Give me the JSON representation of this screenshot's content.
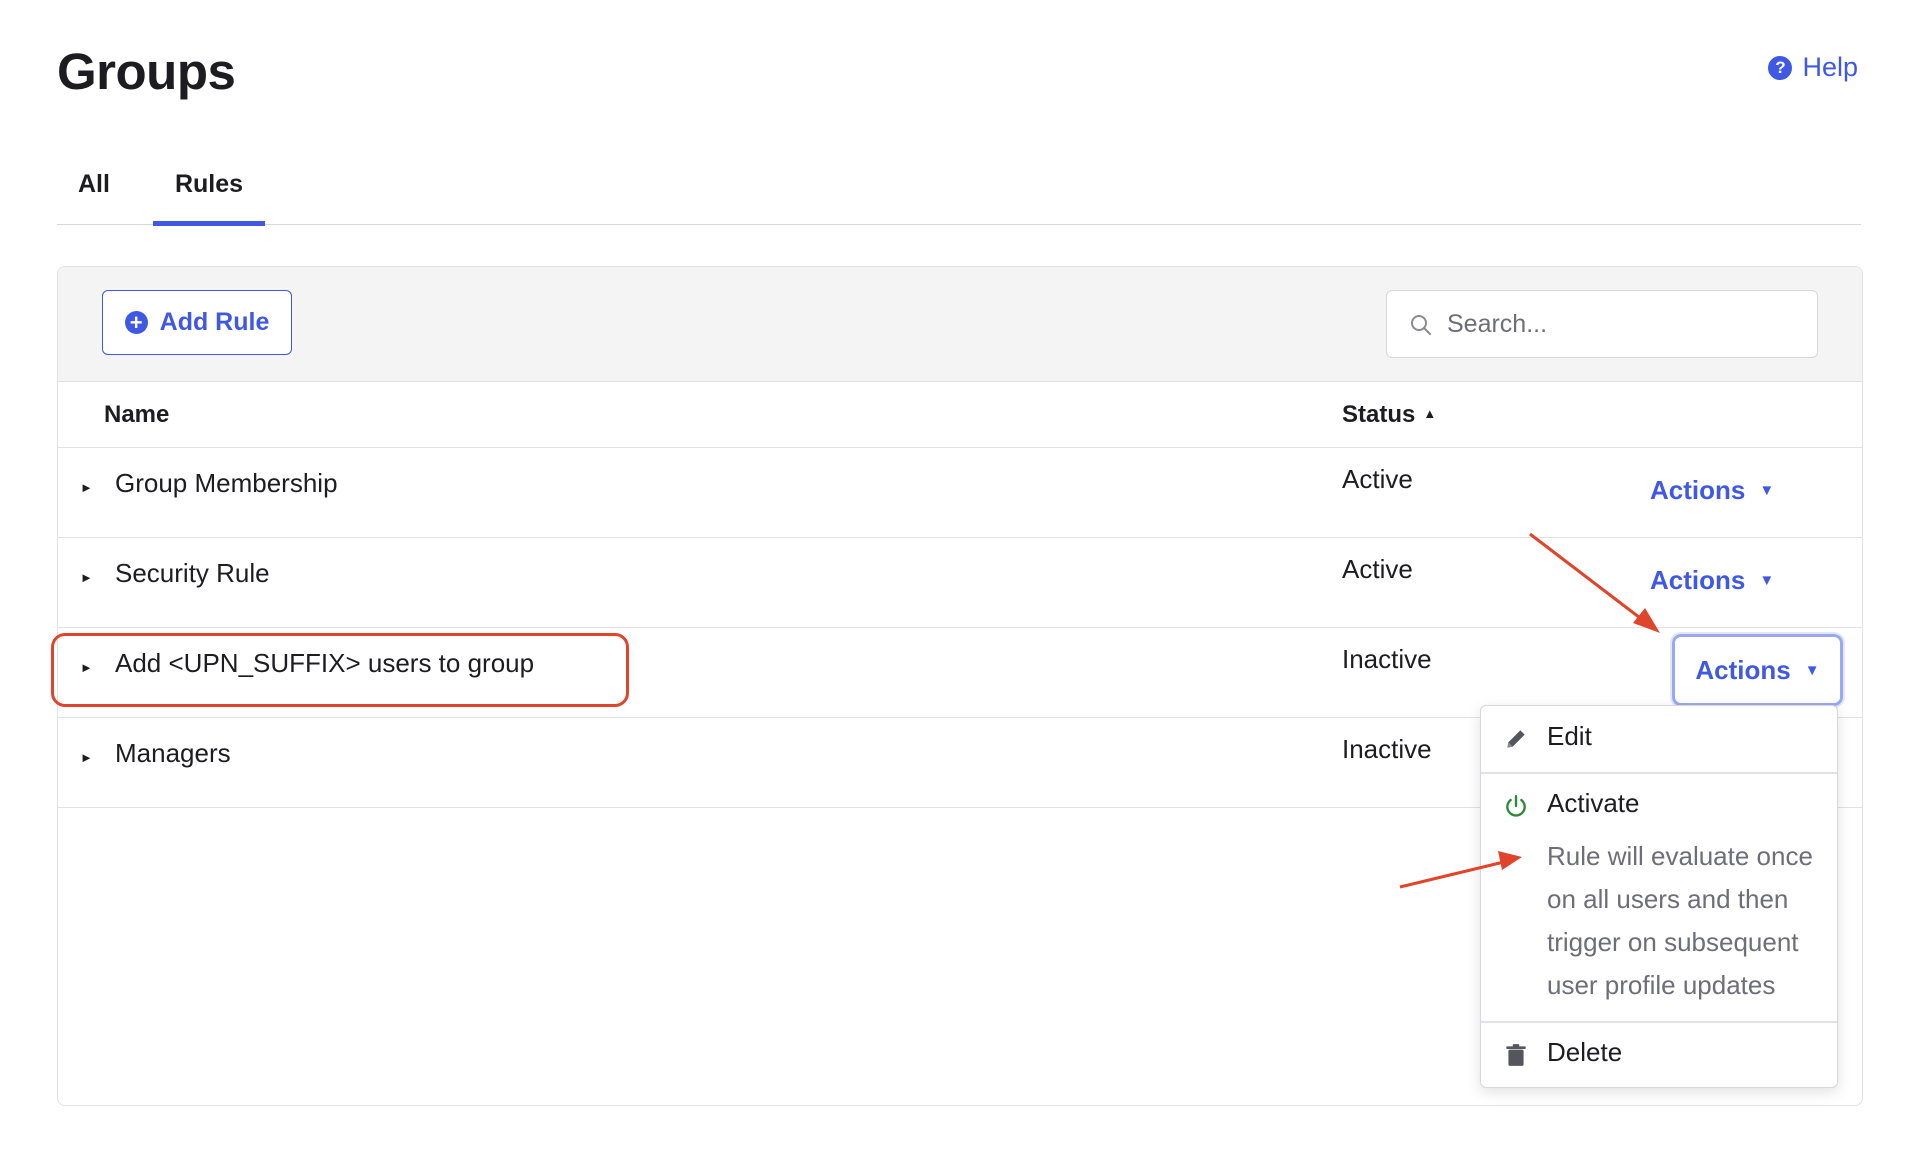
{
  "page": {
    "title": "Groups",
    "help_label": "Help"
  },
  "tabs": [
    {
      "label": "All",
      "selected": false
    },
    {
      "label": "Rules",
      "selected": true
    }
  ],
  "toolbar": {
    "add_rule_label": "Add Rule",
    "search_placeholder": "Search..."
  },
  "table": {
    "columns": {
      "name": "Name",
      "status": "Status"
    },
    "sort_indicator": "▲",
    "rows": [
      {
        "name": "Group Membership",
        "status": "Active",
        "actions_label": "Actions"
      },
      {
        "name": "Security Rule",
        "status": "Active",
        "actions_label": "Actions"
      },
      {
        "name": "Add <UPN_SUFFIX> users to group",
        "status": "Inactive",
        "actions_label": "Actions"
      },
      {
        "name": "Managers",
        "status": "Inactive",
        "actions_label": ""
      }
    ]
  },
  "actions_menu": {
    "edit_label": "Edit",
    "activate_label": "Activate",
    "activate_description": "Rule will evaluate once on all users and then trigger on subsequent user profile updates",
    "delete_label": "Delete"
  },
  "icons": {
    "help": "help-circle-icon",
    "add": "plus-circle-icon",
    "search": "search-icon",
    "edit": "pencil-icon",
    "activate": "power-icon",
    "delete": "trash-icon"
  },
  "colors": {
    "accent": "#3f59e4",
    "annotation": "#e0452b",
    "activate_icon": "#2f8a3c",
    "muted_text": "#6e6e78"
  }
}
